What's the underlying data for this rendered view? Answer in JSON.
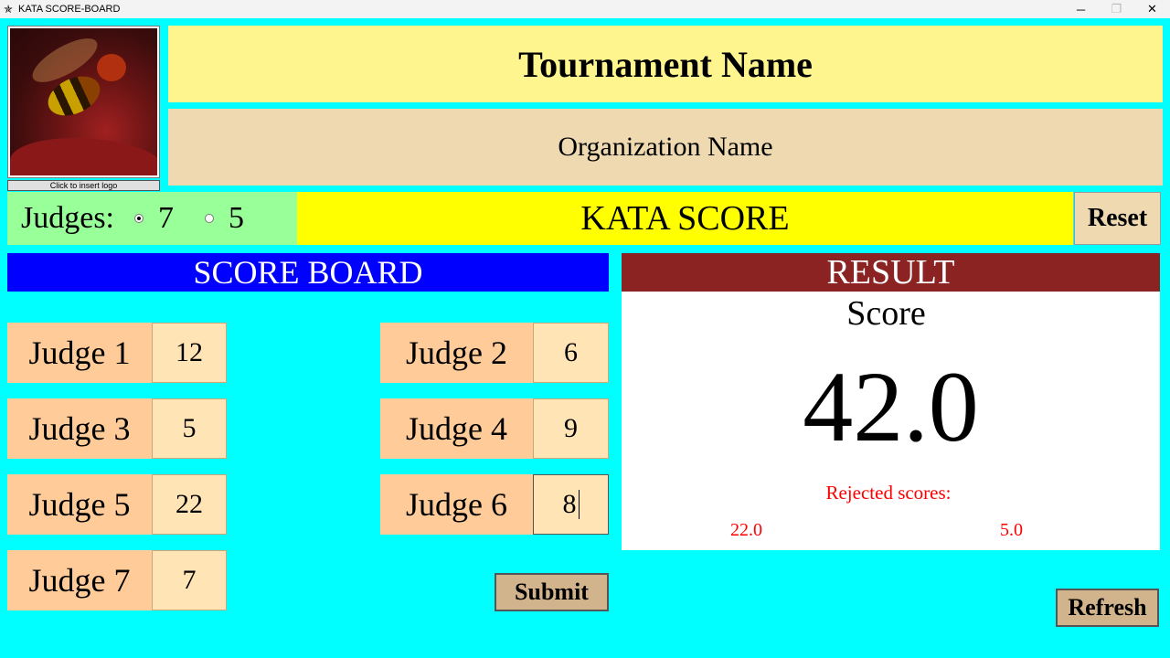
{
  "window": {
    "title": "KATA SCORE-BOARD",
    "icon": "star-app-icon",
    "controls": {
      "minimize": "─",
      "maximize": "❐",
      "close": "✕"
    }
  },
  "header": {
    "logo_caption": "Click to insert logo",
    "tournament_name": "Tournament Name",
    "organization_name": "Organization Name"
  },
  "judges_selector": {
    "label": "Judges:",
    "options": [
      {
        "label": "7",
        "selected": true
      },
      {
        "label": "5",
        "selected": false
      }
    ]
  },
  "kata_title": "KATA SCORE",
  "reset_label": "Reset",
  "scoreboard": {
    "title": "SCORE BOARD",
    "judges": [
      {
        "label": "Judge 1",
        "value": "12"
      },
      {
        "label": "Judge 2",
        "value": "6"
      },
      {
        "label": "Judge 3",
        "value": "5"
      },
      {
        "label": "Judge 4",
        "value": "9"
      },
      {
        "label": "Judge 5",
        "value": "22"
      },
      {
        "label": "Judge 6",
        "value": "8"
      },
      {
        "label": "Judge 7",
        "value": "7"
      }
    ],
    "submit_label": "Submit"
  },
  "result": {
    "title": "RESULT",
    "score_label": "Score",
    "score_value": "42.0",
    "rejected_label": "Rejected scores:",
    "rejected_values": [
      "22.0",
      "5.0"
    ]
  },
  "refresh_label": "Refresh",
  "colors": {
    "background": "#00ffff",
    "tournament_bg": "#fff58f",
    "organization_bg": "#eed9b0",
    "judges_bg": "#99ff99",
    "kata_bg": "#ffff00",
    "scoreboard_header_bg": "#0000ff",
    "result_header_bg": "#8b2323",
    "judge_label_bg": "#ffcc99",
    "judge_input_bg": "#ffe4b5",
    "rejected_text": "#ff0000"
  }
}
